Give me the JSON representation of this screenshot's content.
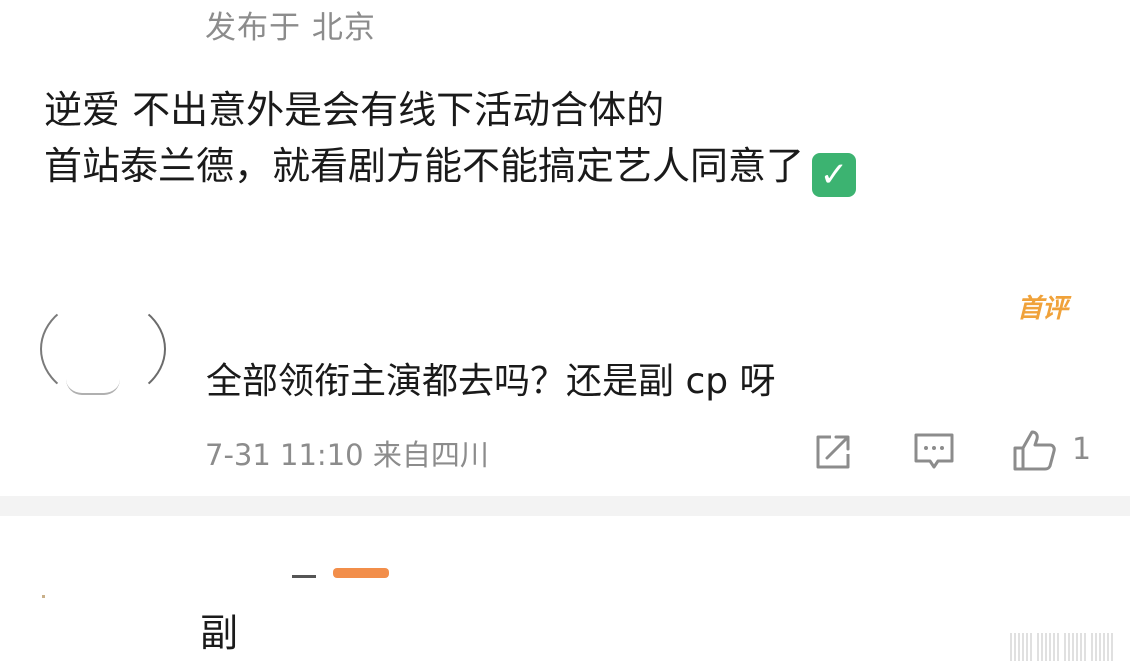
{
  "post": {
    "location": "发布于 北京",
    "lines": [
      "逆爱 不出意外是会有线下活动合体的",
      "首站泰兰德，就看剧方能不能搞定艺人同意了"
    ],
    "emoji": "✓",
    "emoji_icon": "white-check-mark-icon"
  },
  "comment": {
    "badge": "首评",
    "text": "全部领衔主演都去吗？还是副 cp 呀",
    "meta": "7-31 11:10 来自四川",
    "like_count": "1"
  },
  "reply": {
    "text": "副"
  },
  "colors": {
    "badge": "#f0a23a",
    "meta": "#8c8c8c",
    "emoji_bg": "#3cb371"
  }
}
